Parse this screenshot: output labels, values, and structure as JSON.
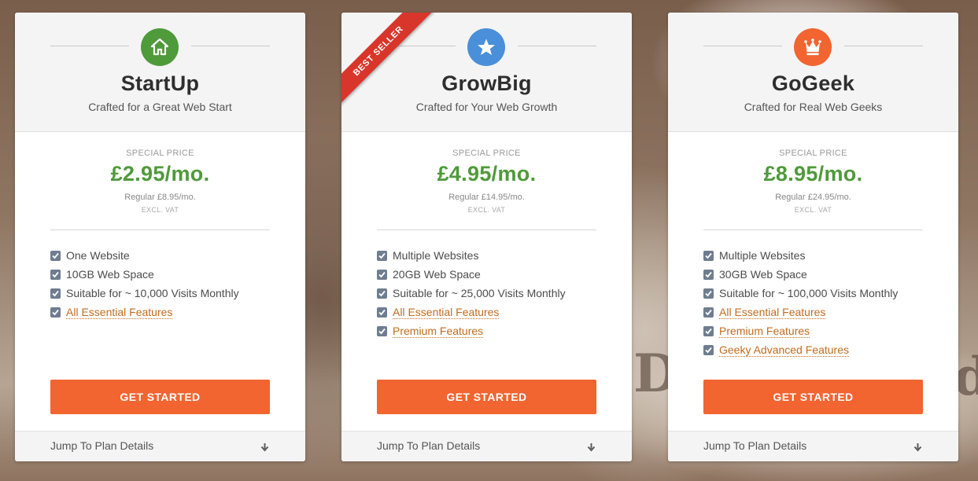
{
  "plans": [
    {
      "name": "StartUp",
      "subtitle": "Crafted for a Great Web Start",
      "icon": "home-icon",
      "icon_color": "#4f9a3a",
      "special_price_label": "SPECIAL PRICE",
      "price": "£2.95/mo.",
      "regular_price": "Regular £8.95/mo.",
      "vat_note": "EXCL. VAT",
      "features": [
        {
          "label": "One Website",
          "link": false
        },
        {
          "label": "10GB Web Space",
          "link": false
        },
        {
          "label": "Suitable for ~ 10,000 Visits Monthly",
          "link": false
        },
        {
          "label": "All Essential Features",
          "link": true
        }
      ],
      "cta_label": "GET STARTED",
      "jump_label": "Jump To Plan Details"
    },
    {
      "name": "GrowBig",
      "subtitle": "Crafted for Your Web Growth",
      "icon": "star-icon",
      "icon_color": "#4a8fd9",
      "ribbon": "BEST SELLER",
      "special_price_label": "SPECIAL PRICE",
      "price": "£4.95/mo.",
      "regular_price": "Regular £14.95/mo.",
      "vat_note": "EXCL. VAT",
      "features": [
        {
          "label": "Multiple Websites",
          "link": false
        },
        {
          "label": "20GB Web Space",
          "link": false
        },
        {
          "label": "Suitable for ~ 25,000 Visits Monthly",
          "link": false
        },
        {
          "label": "All Essential Features",
          "link": true
        },
        {
          "label": "Premium Features",
          "link": true
        }
      ],
      "cta_label": "GET STARTED",
      "jump_label": "Jump To Plan Details"
    },
    {
      "name": "GoGeek",
      "subtitle": "Crafted for Real Web Geeks",
      "icon": "crown-icon",
      "icon_color": "#f26430",
      "special_price_label": "SPECIAL PRICE",
      "price": "£8.95/mo.",
      "regular_price": "Regular £24.95/mo.",
      "vat_note": "EXCL. VAT",
      "features": [
        {
          "label": "Multiple Websites",
          "link": false
        },
        {
          "label": "30GB Web Space",
          "link": false
        },
        {
          "label": "Suitable for ~ 100,000 Visits Monthly",
          "link": false
        },
        {
          "label": "All Essential Features",
          "link": true
        },
        {
          "label": "Premium Features",
          "link": true
        },
        {
          "label": "Geeky Advanced Features",
          "link": true
        }
      ],
      "cta_label": "GET STARTED",
      "jump_label": "Jump To Plan Details"
    }
  ],
  "colors": {
    "price_green": "#4f9a3a",
    "cta_orange": "#f26430",
    "link_orange": "#c26c1f",
    "ribbon_red": "#d9362b",
    "checkbox_gray": "#6f7d90"
  }
}
